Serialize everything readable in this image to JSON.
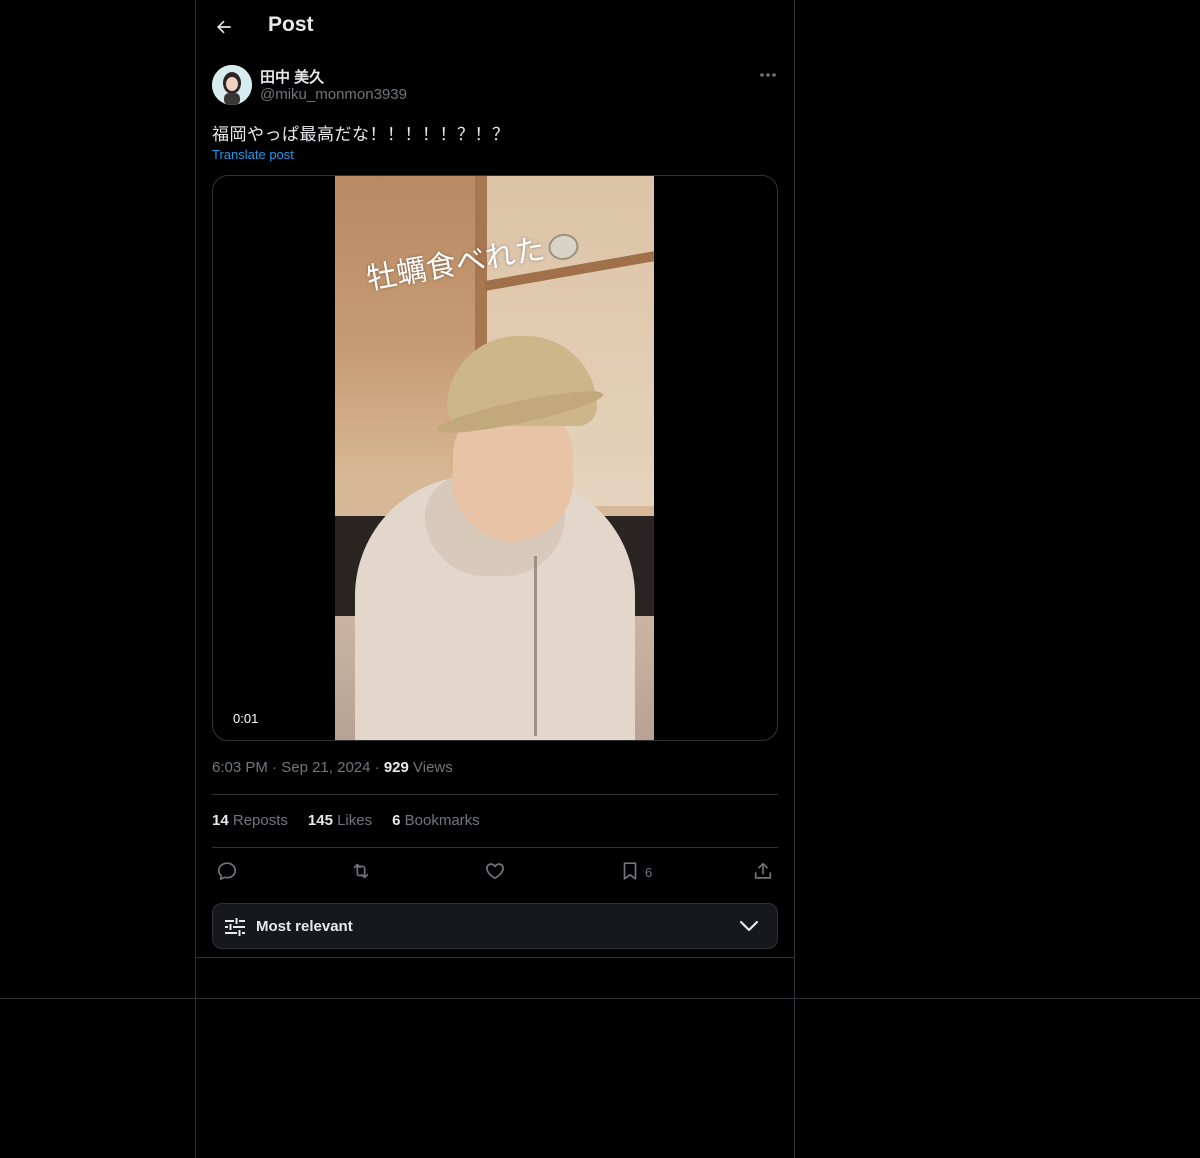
{
  "header": {
    "title": "Post"
  },
  "author": {
    "display_name": "田中 美久",
    "handle": "@miku_monmon3939"
  },
  "post": {
    "text": "福岡やっぱ最高だな！！！！！？！？",
    "translate_label": "Translate post",
    "video_overlay_text": "牡蠣食べれた",
    "video_time": "0:01"
  },
  "meta": {
    "time": "6:03 PM",
    "separator": "·",
    "date": "Sep 21, 2024",
    "views_count": "929",
    "views_label": "Views"
  },
  "stats": {
    "reposts_count": "14",
    "reposts_label": "Reposts",
    "likes_count": "145",
    "likes_label": "Likes",
    "bookmarks_count": "6",
    "bookmarks_label": "Bookmarks"
  },
  "actions": {
    "bookmark_count": "6"
  },
  "sort": {
    "label": "Most relevant"
  },
  "icons": {
    "back": "arrow-left-icon",
    "more": "more-horizontal-icon",
    "reply": "reply-icon",
    "repost": "repost-icon",
    "like": "heart-icon",
    "bookmark": "bookmark-icon",
    "share": "share-icon",
    "sort": "sliders-icon",
    "chevron": "chevron-down-icon"
  },
  "colors": {
    "background": "#000000",
    "text": "#e7e9ea",
    "muted": "#71767b",
    "link": "#1d9bf0",
    "border": "#2f3336"
  }
}
